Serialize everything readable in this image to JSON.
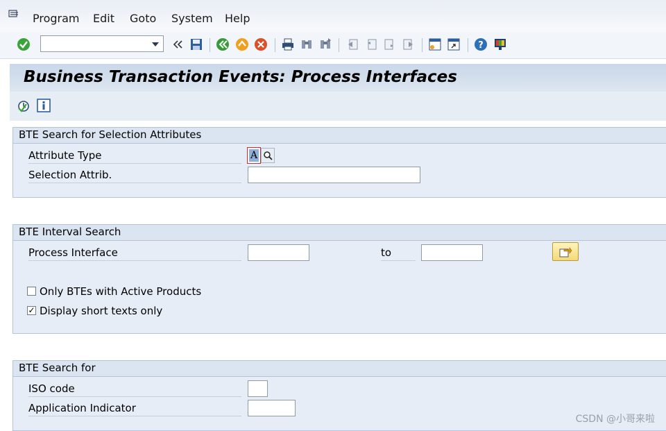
{
  "menu": {
    "items": [
      "Program",
      "Edit",
      "Goto",
      "System",
      "Help"
    ]
  },
  "toolbar": {
    "command_value": "",
    "icons": [
      "enter-icon",
      "back-arrows-icon",
      "save-icon",
      "back-icon",
      "exit-icon",
      "cancel-icon",
      "print-icon",
      "find-icon",
      "find-next-icon",
      "first-page-icon",
      "previous-page-icon",
      "next-page-icon",
      "last-page-icon",
      "new-session-icon",
      "shortcut-icon",
      "help-icon",
      "layout-icon"
    ]
  },
  "title": "Business Transaction Events: Process Interfaces",
  "app_toolbar": {
    "icons": [
      "execute-icon",
      "information-icon"
    ]
  },
  "group1": {
    "header": "BTE Search for Selection Attributes",
    "attribute_type_label": "Attribute Type",
    "attribute_type_value": "A",
    "selection_attrib_label": "Selection Attrib.",
    "selection_attrib_value": ""
  },
  "group2": {
    "header": "BTE Interval Search",
    "process_interface_label": "Process Interface",
    "process_interface_from": "",
    "to_label": "to",
    "process_interface_to": "",
    "only_active_label": "Only BTEs with Active Products",
    "only_active_checked": false,
    "short_texts_label": "Display short texts only",
    "short_texts_checked": true,
    "check_mark": "✓"
  },
  "group3": {
    "header": "BTE Search for",
    "iso_code_label": "ISO code",
    "iso_code_value": "",
    "app_indicator_label": "Application Indicator",
    "app_indicator_value": ""
  },
  "watermark": "CSDN @小哥来啦",
  "colors": {
    "title_bg": "#c9d7e8",
    "group_bg": "#e6edf6",
    "group_header_bg": "#dbe5f1"
  }
}
